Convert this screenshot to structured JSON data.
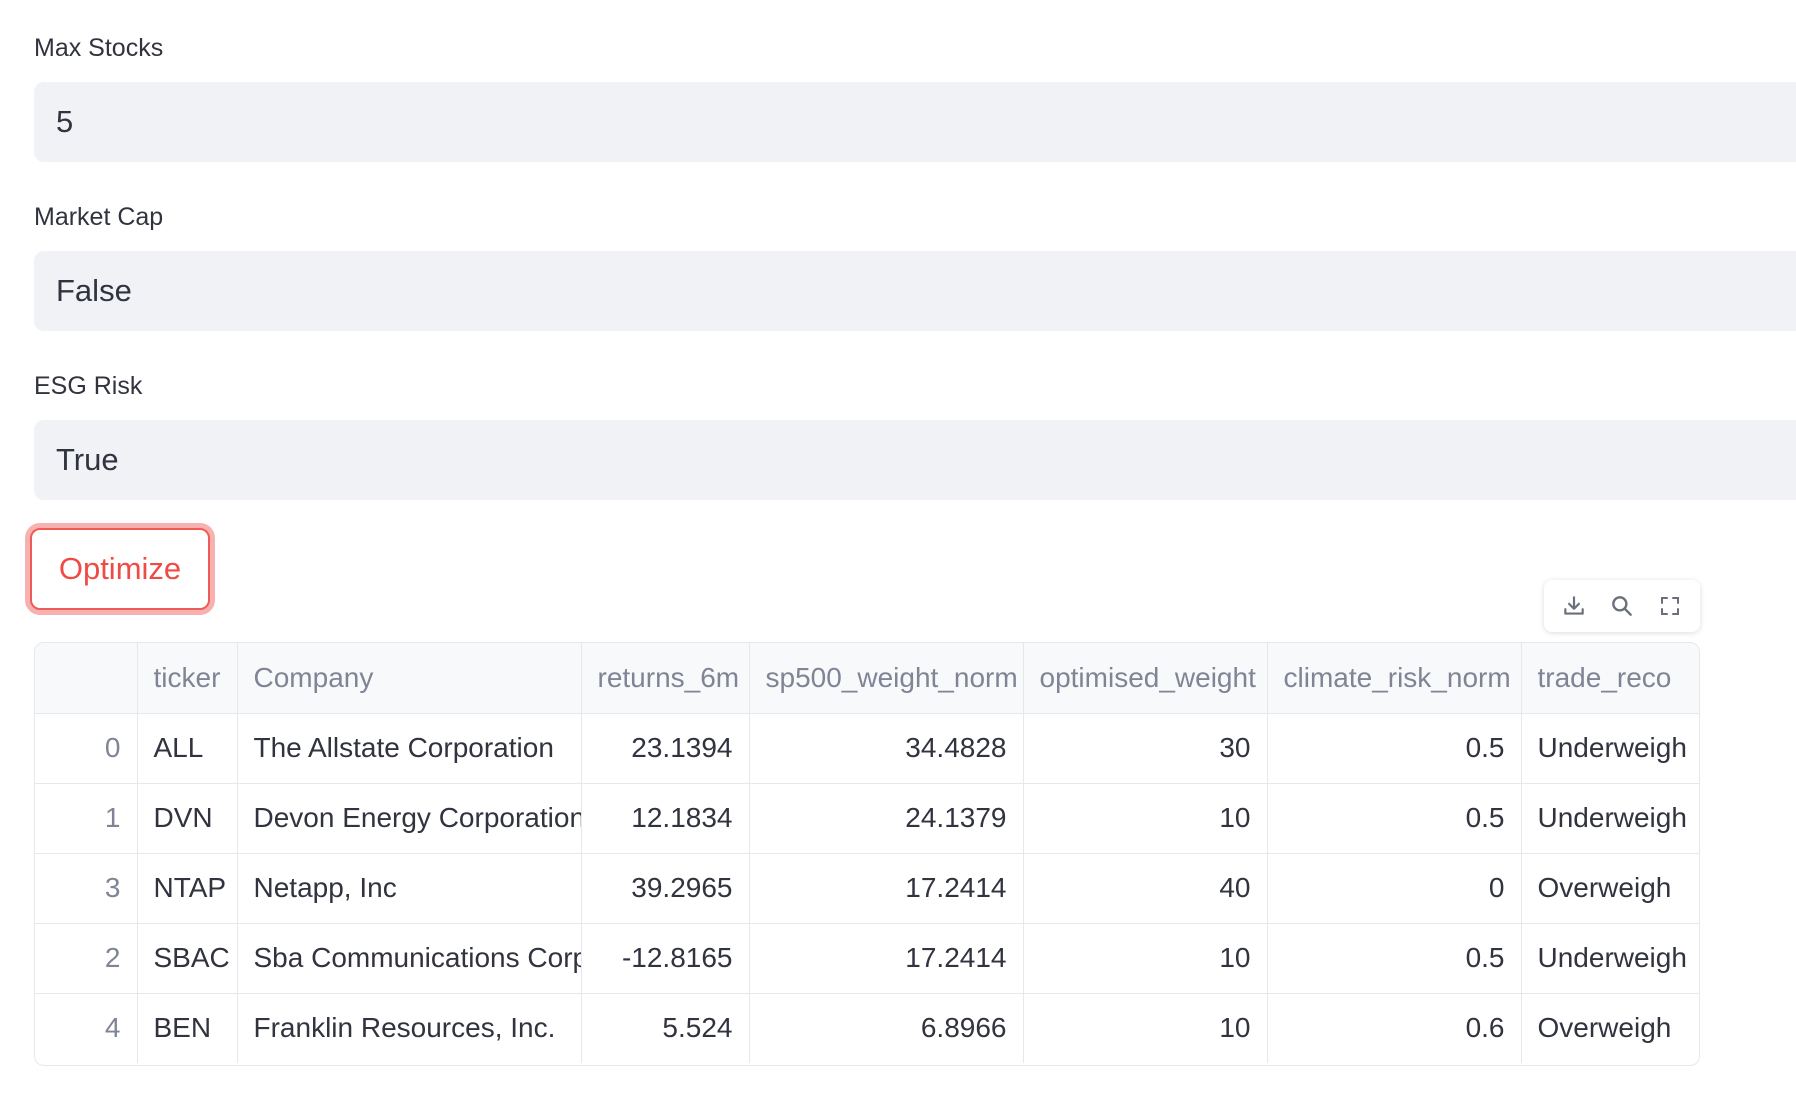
{
  "form": {
    "max_stocks": {
      "label": "Max Stocks",
      "value": "5"
    },
    "market_cap": {
      "label": "Market Cap",
      "value": "False"
    },
    "esg_risk": {
      "label": "ESG Risk",
      "value": "True"
    }
  },
  "optimize_button": {
    "label": "Optimize",
    "accent": "#ef4b45"
  },
  "toolbar": {
    "icons": [
      "download-icon",
      "search-icon",
      "fullscreen-icon"
    ]
  },
  "table": {
    "columns": [
      "",
      "ticker",
      "Company",
      "returns_6m",
      "sp500_weight_norm",
      "optimised_weight",
      "climate_risk_norm",
      "trade_reco"
    ],
    "rows": [
      [
        "0",
        "ALL",
        "The Allstate Corporation",
        "23.1394",
        "34.4828",
        "30",
        "0.5",
        "Underweigh"
      ],
      [
        "1",
        "DVN",
        "Devon Energy Corporation",
        "12.1834",
        "24.1379",
        "10",
        "0.5",
        "Underweigh"
      ],
      [
        "3",
        "NTAP",
        "Netapp, Inc",
        "39.2965",
        "17.2414",
        "40",
        "0",
        "Overweigh"
      ],
      [
        "2",
        "SBAC",
        "Sba Communications Corp",
        "-12.8165",
        "17.2414",
        "10",
        "0.5",
        "Underweigh"
      ],
      [
        "4",
        "BEN",
        "Franklin Resources, Inc.",
        "5.524",
        "6.8966",
        "10",
        "0.6",
        "Overweigh"
      ]
    ]
  }
}
